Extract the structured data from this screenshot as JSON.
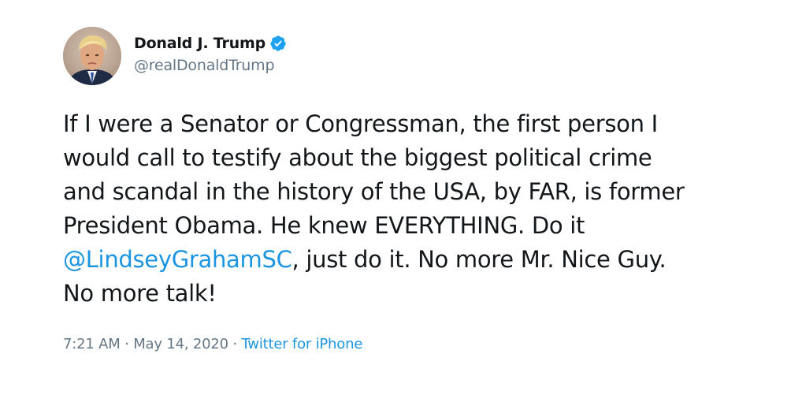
{
  "user": {
    "display_name": "Donald J. Trump",
    "handle": "@realDonaldTrump",
    "verified": true,
    "avatar_icon": "profile-photo"
  },
  "tweet": {
    "lines": [
      "If I were a Senator or Congressman, the first person I",
      "would call to testify about the biggest political crime",
      "and scandal in the history of the USA, by FAR, is former",
      "President Obama. He knew EVERYTHING. Do it",
      ", just do it. No more Mr. Nice Guy.",
      "No more talk!"
    ],
    "mention": "@LindseyGrahamSC"
  },
  "meta": {
    "time": "7:21 AM",
    "separator": "·",
    "date": "May 14, 2020",
    "source": "Twitter for iPhone"
  },
  "colors": {
    "link": "#1b95e0",
    "secondary_text": "#657786",
    "primary_text": "#14171a",
    "verified_badge": "#1da1f2"
  }
}
